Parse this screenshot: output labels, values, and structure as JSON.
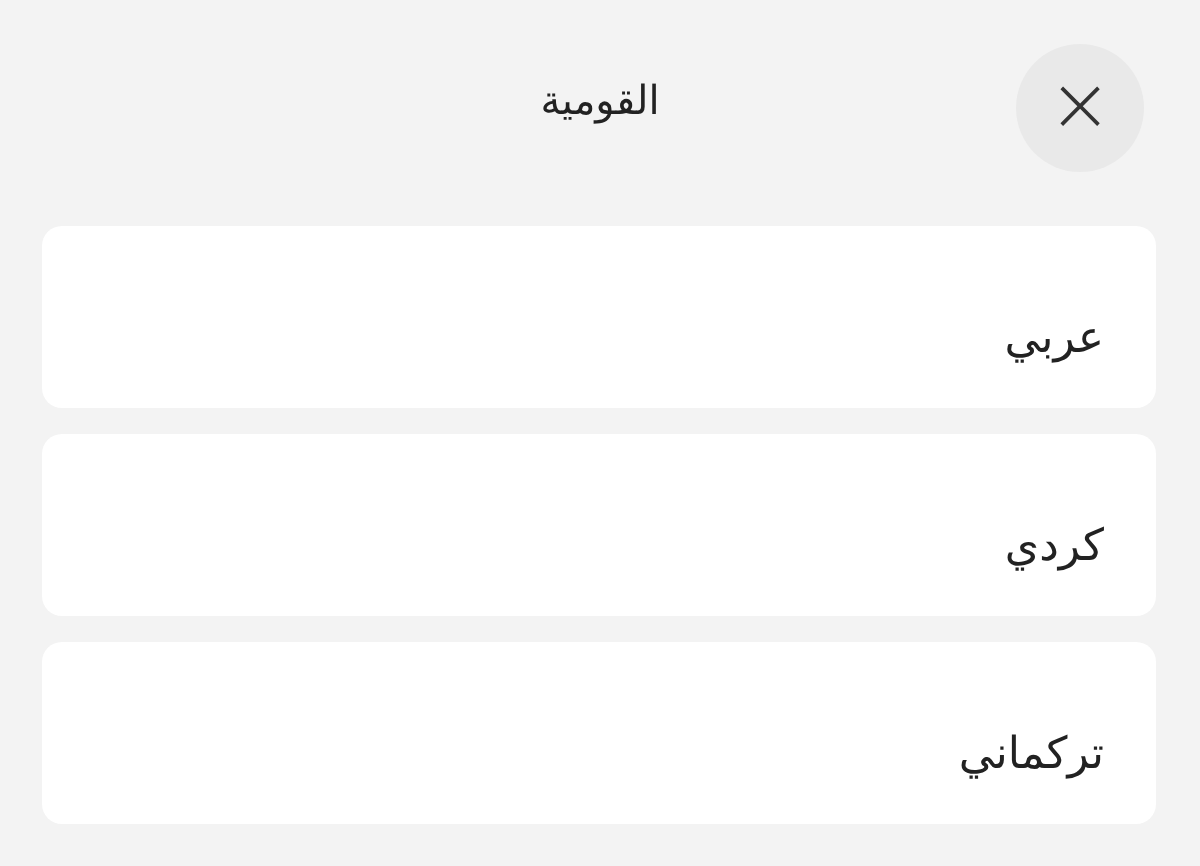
{
  "header": {
    "title": "القومية",
    "close_label": "×"
  },
  "options": [
    {
      "label": "عربي"
    },
    {
      "label": "كردي"
    },
    {
      "label": "تركماني"
    }
  ]
}
